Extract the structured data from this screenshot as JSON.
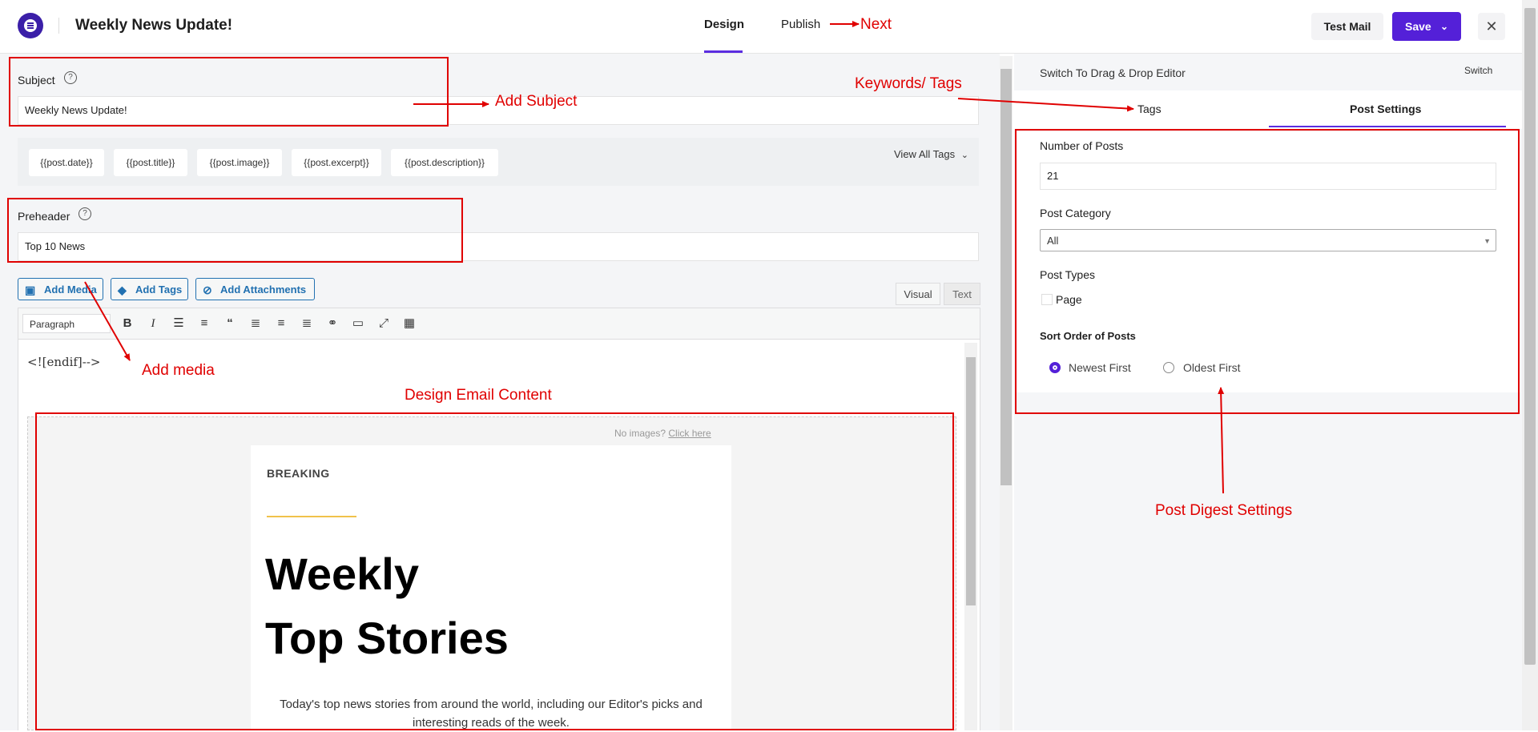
{
  "header": {
    "title": "Weekly News Update!",
    "tabs": [
      {
        "label": "Design"
      },
      {
        "label": "Publish"
      }
    ],
    "test_mail": "Test Mail",
    "save": "Save",
    "close": "✕",
    "accent": "#5420d8"
  },
  "subject": {
    "label": "Subject",
    "value": "Weekly News Update!"
  },
  "tags": {
    "chips": [
      "{{post.date}}",
      "{{post.title}}",
      "{{post.image}}",
      "{{post.excerpt}}",
      "{{post.description}}"
    ],
    "view_all": "View All Tags"
  },
  "preheader": {
    "label": "Preheader",
    "value": "Top 10 News"
  },
  "media_buttons": {
    "add_media": "Add Media",
    "add_tags": "Add Tags",
    "add_attachments": "Add Attachments"
  },
  "editor_tabs": {
    "visual": "Visual",
    "text": "Text"
  },
  "toolbar": {
    "format": "Paragraph"
  },
  "editor": {
    "code": "<![endif]-->",
    "no_images": "No images?",
    "click_here": "Click here",
    "breaking": "BREAKING",
    "headline_1": "Weekly",
    "headline_2": "Top Stories",
    "intro": "Today's top news stories from around the world, including our Editor's picks and interesting reads of the week."
  },
  "right_panel": {
    "switch_label": "Switch To Drag & Drop Editor",
    "switch_button": "Switch",
    "tabs": [
      {
        "label": "Tags"
      },
      {
        "label": "Post Settings"
      }
    ],
    "number_of_posts_label": "Number of Posts",
    "number_of_posts_value": "21",
    "post_category_label": "Post Category",
    "post_category_value": "All",
    "post_types_label": "Post Types",
    "post_type_page": "Page",
    "sort_order_label": "Sort Order of Posts",
    "sort_newest": "Newest First",
    "sort_oldest": "Oldest First",
    "sort_selected": "Newest First"
  },
  "annotations": {
    "next": "Next",
    "add_subject": "Add Subject",
    "keywords_tags": "Keywords/ Tags",
    "add_media": "Add media",
    "design_email_content": "Design Email Content",
    "post_digest_settings": "Post Digest Settings",
    "color": "#e00000"
  }
}
